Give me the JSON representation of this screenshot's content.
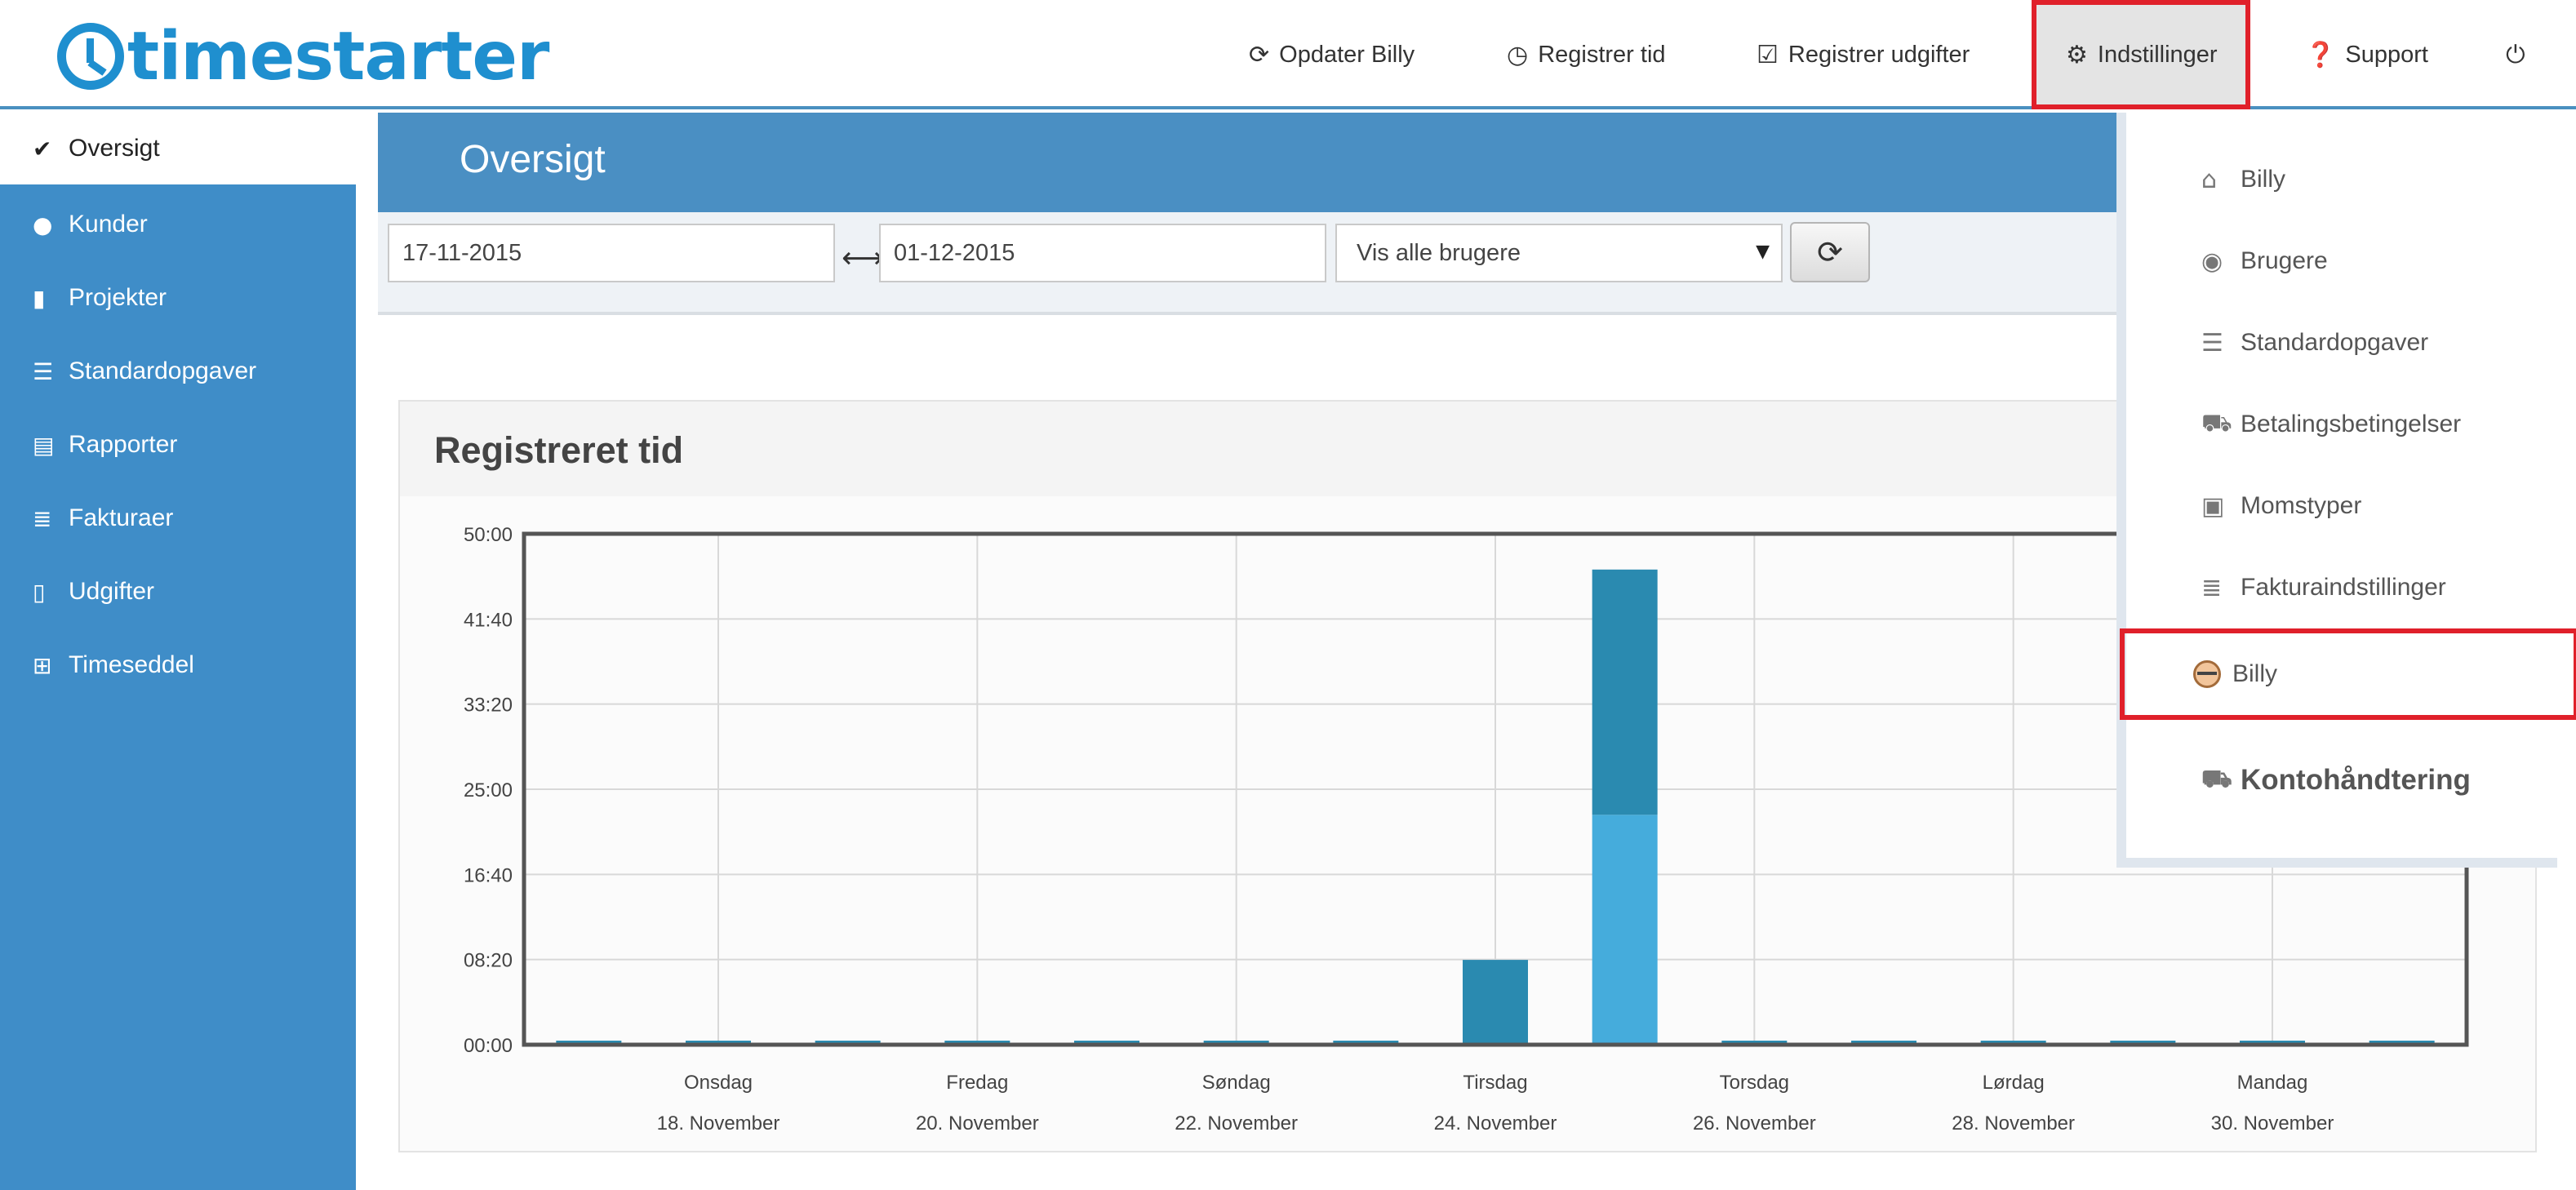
{
  "brand": {
    "name": "timestarter"
  },
  "topnav": {
    "items": [
      {
        "label": "Opdater Billy",
        "icon": "refresh-icon"
      },
      {
        "label": "Registrer tid",
        "icon": "clock-icon"
      },
      {
        "label": "Registrer udgifter",
        "icon": "check-square-icon"
      },
      {
        "label": "Indstillinger",
        "icon": "gear-icon"
      },
      {
        "label": "Support",
        "icon": "question-circle-icon"
      }
    ],
    "power_icon": "power-icon"
  },
  "sidebar": {
    "items": [
      {
        "label": "Oversigt",
        "icon": "check-icon",
        "active": true
      },
      {
        "label": "Kunder",
        "icon": "globe-icon"
      },
      {
        "label": "Projekter",
        "icon": "book-icon"
      },
      {
        "label": "Standardopgaver",
        "icon": "server-icon"
      },
      {
        "label": "Rapporter",
        "icon": "print-icon"
      },
      {
        "label": "Fakturaer",
        "icon": "list-icon"
      },
      {
        "label": "Udgifter",
        "icon": "file-icon"
      },
      {
        "label": "Timeseddel",
        "icon": "grid-icon"
      }
    ]
  },
  "page": {
    "title": "Oversigt"
  },
  "filters": {
    "from_date": "17-11-2015",
    "to_date": "01-12-2015",
    "user_select": "Vis alle brugere"
  },
  "panel": {
    "title": "Registreret tid"
  },
  "settings_menu": {
    "items": [
      {
        "label": "Billy",
        "icon": "home-icon"
      },
      {
        "label": "Brugere",
        "icon": "eye-icon"
      },
      {
        "label": "Standardopgaver",
        "icon": "server-icon"
      },
      {
        "label": "Betalingsbetingelser",
        "icon": "cart-icon"
      },
      {
        "label": "Momstyper",
        "icon": "briefcase-icon"
      },
      {
        "label": "Fakturaindstillinger",
        "icon": "list-icon"
      },
      {
        "label": "Billy",
        "icon": "user-avatar-icon",
        "highlighted": true
      },
      {
        "label": "Kontohåndtering",
        "icon": "cart-icon",
        "bold": true
      }
    ]
  },
  "colors": {
    "accent": "#3f8dc8",
    "highlight": "#e0202a",
    "series_dark": "#2a8ab0",
    "series_light": "#45acdc"
  },
  "chart_data": {
    "type": "bar",
    "stacked": true,
    "title": "Registreret tid",
    "y_tick_labels": [
      "00:00",
      "08:20",
      "16:40",
      "25:00",
      "33:20",
      "41:40",
      "50:00"
    ],
    "ylim": [
      0,
      50
    ],
    "y_unit": "hours",
    "x_label_days": [
      "Onsdag",
      "Fredag",
      "Søndag",
      "Tirsdag",
      "Torsdag",
      "Lørdag",
      "Mandag"
    ],
    "x_label_dates": [
      "18. November",
      "20. November",
      "22. November",
      "24. November",
      "26. November",
      "28. November",
      "30. November"
    ],
    "categories": [
      "17-11-2015",
      "18-11-2015",
      "19-11-2015",
      "20-11-2015",
      "21-11-2015",
      "22-11-2015",
      "23-11-2015",
      "24-11-2015",
      "25-11-2015",
      "26-11-2015",
      "27-11-2015",
      "28-11-2015",
      "29-11-2015",
      "30-11-2015",
      "01-12-2015"
    ],
    "series": [
      {
        "color": "#45acdc",
        "values": [
          0,
          0,
          0,
          0,
          0,
          0,
          0,
          0,
          22.5,
          0,
          0,
          0,
          0,
          0,
          0
        ]
      },
      {
        "color": "#2a8ab0",
        "values": [
          0,
          0,
          0,
          0,
          0,
          0,
          0,
          8.3,
          24,
          0,
          0,
          0,
          0,
          0,
          0
        ]
      }
    ],
    "grid": true
  }
}
